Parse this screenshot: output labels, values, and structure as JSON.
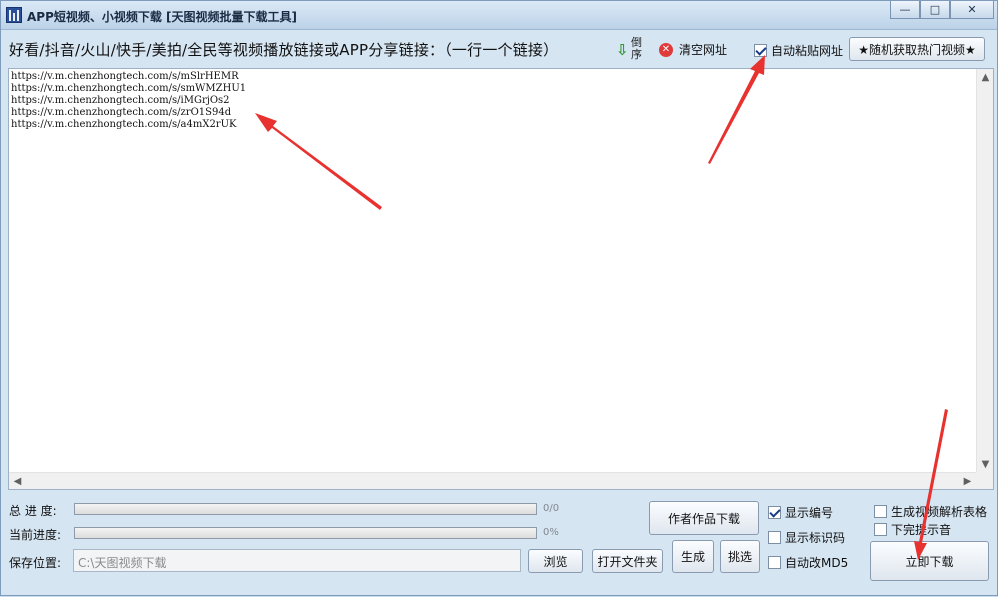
{
  "window": {
    "title": "APP短视频、小视频下载 [天图视频批量下载工具]",
    "buttons": {
      "minimize": "—",
      "maximize": "□",
      "close": "✕"
    }
  },
  "toolbar": {
    "prompt": "好看/抖音/火山/快手/美拍/全民等视频播放链接或APP分享链接：（一行一个链接）",
    "reverse_label": "倒序",
    "clear_label": "清空网址",
    "auto_paste_label": "自动粘贴网址",
    "auto_paste_checked": true,
    "hot_videos_label": "★随机获取热门视频★"
  },
  "links": [
    "https://v.m.chenzhongtech.com/s/mSlrHEMR",
    "https://v.m.chenzhongtech.com/s/smWMZHU1",
    "https://v.m.chenzhongtech.com/s/iMGrjOs2",
    "https://v.m.chenzhongtech.com/s/zrO1S94d",
    "https://v.m.chenzhongtech.com/s/a4mX2rUK"
  ],
  "progress": {
    "total_label": "总 进 度:",
    "total_value": "0/0",
    "total_fraction": 0,
    "current_label": "当前进度:",
    "current_value": "0%",
    "current_fraction": 0
  },
  "save": {
    "label": "保存位置:",
    "path": "C:\\天图视频下载",
    "browse_label": "浏览",
    "open_folder_label": "打开文件夹"
  },
  "actions": {
    "author_download": "作者作品下载",
    "generate": "生成",
    "pick": "挑选",
    "download_now": "立即下载"
  },
  "options": [
    {
      "label": "显示编号",
      "checked": true
    },
    {
      "label": "显示标识码",
      "checked": false
    },
    {
      "label": "自动改MD5",
      "checked": false
    },
    {
      "label": "生成视频解析表格",
      "checked": false
    },
    {
      "label": "下完提示音",
      "checked": false
    }
  ],
  "colors": {
    "accent_arrow": "#e8322f",
    "window_bg": "#d6e5f2",
    "progress_fill": "#3aa13a"
  }
}
